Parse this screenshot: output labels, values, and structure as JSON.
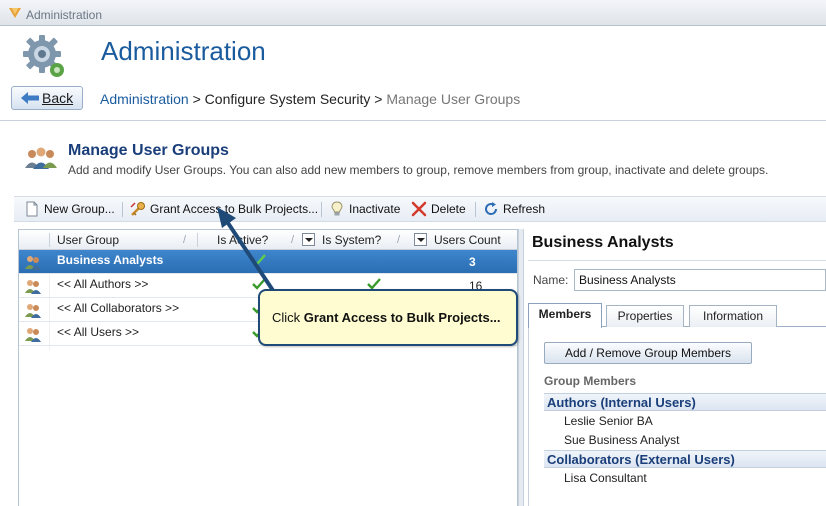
{
  "window": {
    "title": "Administration"
  },
  "header": {
    "title": "Administration",
    "back_label": "Back",
    "breadcrumb": {
      "link": "Administration",
      "sep1": " > ",
      "middle": "Configure System Security",
      "sep2": " > ",
      "current": "Manage User Groups"
    }
  },
  "section": {
    "title": "Manage User Groups",
    "description": "Add and modify User Groups. You can also add new members to group, remove members from group, inactivate and delete groups."
  },
  "toolbar": {
    "new_group": "New Group...",
    "grant_access": "Grant Access to Bulk Projects...",
    "inactivate": "Inactivate",
    "delete": "Delete",
    "refresh": "Refresh"
  },
  "grid": {
    "columns": [
      "User Group",
      "Is Active?",
      "Is System?",
      "Users Count"
    ],
    "rows": [
      {
        "name": "Business Analysts",
        "active": true,
        "system": false,
        "count": "3",
        "selected": true
      },
      {
        "name": "<< All Authors >>",
        "active": true,
        "system": true,
        "count": "16",
        "selected": false
      },
      {
        "name": "<< All Collaborators >>",
        "active": true,
        "system": true,
        "count": "",
        "selected": false
      },
      {
        "name": "<< All Users >>",
        "active": true,
        "system": true,
        "count": "",
        "selected": false
      }
    ]
  },
  "detail": {
    "title": "Business Analysts",
    "name_label": "Name:",
    "name_value": "Business Analysts",
    "tabs": [
      "Members",
      "Properties",
      "Information"
    ],
    "active_tab": "Members",
    "add_remove_label": "Add / Remove Group Members",
    "group_members_label": "Group Members",
    "groups": [
      {
        "heading": "Authors (Internal Users)",
        "members": [
          "Leslie Senior BA",
          "Sue Business Analyst"
        ]
      },
      {
        "heading": "Collaborators (External Users)",
        "members": [
          "Lisa Consultant"
        ]
      }
    ]
  },
  "callout": {
    "prefix": "Click ",
    "bold": "Grant Access to Bulk Projects..."
  },
  "colors": {
    "accent": "#1a5b9e",
    "selection": "#2f76bf",
    "callout_bg": "#fefcd0",
    "callout_border": "#1f4a78",
    "check": "#3a9a2b"
  },
  "icons": {
    "app": "app-logo-icon",
    "header": "gear-icon",
    "back": "back-arrow-icon",
    "section": "users-group-icon",
    "new_group": "new-document-icon",
    "grant_access": "key-icon",
    "inactivate": "lightbulb-icon",
    "delete": "delete-x-icon",
    "refresh": "refresh-icon",
    "row": "user-group-icon",
    "check": "checkmark-icon"
  }
}
